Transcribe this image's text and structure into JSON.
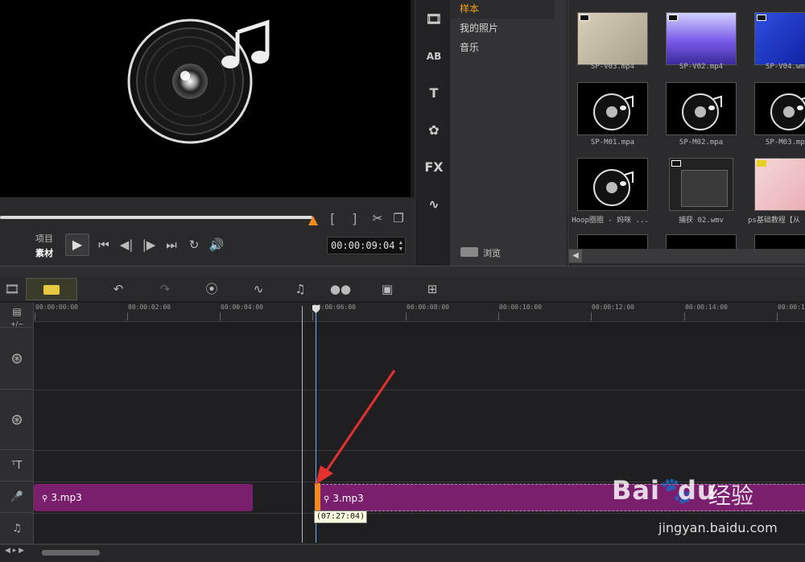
{
  "player": {
    "mode_project": "项目",
    "mode_clip": "素材",
    "bracket_in": "[",
    "bracket_out": "]",
    "timecode": "00:00:09:04",
    "controls": [
      "play",
      "start",
      "prev-frame",
      "next-frame",
      "end",
      "repeat",
      "volume"
    ]
  },
  "library": {
    "tab_icons": [
      "media-icon",
      "transition-icon",
      "title-icon",
      "graphics-icon",
      "fx-icon",
      "path-icon"
    ],
    "nav": [
      {
        "label": "样本",
        "active": true
      },
      {
        "label": "我的照片",
        "active": false
      },
      {
        "label": "音乐",
        "active": false
      }
    ],
    "browse_label": "浏览",
    "thumbnails": [
      {
        "label": "SP-V03.mp4",
        "kind": "video-beige"
      },
      {
        "label": "SP-V02.mp4",
        "kind": "video-purple"
      },
      {
        "label": "SP-V04.wm",
        "kind": "video-blue"
      },
      {
        "label": "SP-M01.mpa",
        "kind": "audio"
      },
      {
        "label": "SP-M02.mpa",
        "kind": "audio"
      },
      {
        "label": "SP-M03.mp",
        "kind": "audio"
      },
      {
        "label": "Hoop圈圈 - 妈咪 ...",
        "kind": "audio"
      },
      {
        "label": "捕获 02.wmv",
        "kind": "video-screen"
      },
      {
        "label": "ps基础教程【从",
        "kind": "video-pink"
      }
    ]
  },
  "timeline": {
    "ruler_ticks": [
      "00:00:00:00",
      "00:00:02:00",
      "00:00:04:00",
      "00:00:06:00",
      "00:00:08:00",
      "00:00:10:00",
      "00:00:12:00",
      "00:00:14:00",
      "00:00:1"
    ],
    "track_header_zoom": "+/−",
    "clips": [
      {
        "label": "3.mp3"
      },
      {
        "label": "3.mp3"
      }
    ],
    "tooltip": "(07:27:04)"
  },
  "watermark": {
    "brand": "Bai",
    "brand_du": "du",
    "product": "经验",
    "url": "jingyan.baidu.com"
  },
  "colors": {
    "clip": "#7a1f6e",
    "accent": "#f08a20",
    "playhead": "#6ab4ff",
    "active_nav": "#f0a020"
  }
}
